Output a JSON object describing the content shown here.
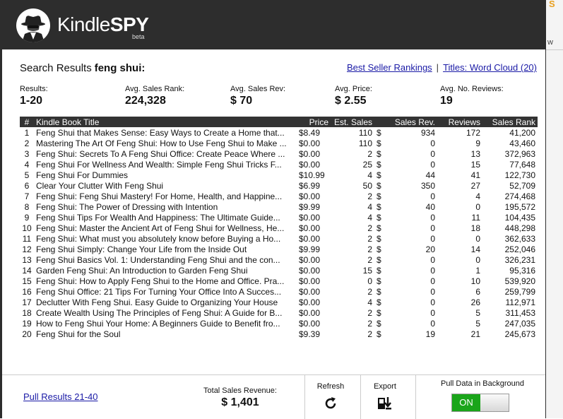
{
  "background": {
    "corner_text": "S",
    "side_text": "w"
  },
  "header": {
    "brand_normal": "Kindle",
    "brand_bold": "SPY",
    "beta": "beta"
  },
  "search": {
    "label": "Search Results",
    "term": "feng shui:"
  },
  "links": {
    "best_seller": "Best Seller Rankings",
    "pipe": "|",
    "word_cloud": "Titles: Word Cloud (20)"
  },
  "stats": [
    {
      "label": "Results:",
      "value": "1-20"
    },
    {
      "label": "Avg. Sales Rank:",
      "value": "224,328"
    },
    {
      "label": "Avg. Sales Rev:",
      "value": "$ 70"
    },
    {
      "label": "Avg. Price:",
      "value": "$ 2.55"
    },
    {
      "label": "Avg. No. Reviews:",
      "value": "19"
    }
  ],
  "table": {
    "headers": [
      "#",
      "Kindle Book Title",
      "Price",
      "Est. Sales",
      "Sales Rev.",
      "Reviews",
      "Sales Rank"
    ],
    "rows": [
      [
        "1",
        "Feng Shui that Makes Sense: Easy Ways to Create a Home that...",
        "$8.49",
        "110",
        "$",
        "934",
        "172",
        "41,200"
      ],
      [
        "2",
        "Mastering The Art Of Feng Shui: How to Use Feng Shui to Make ...",
        "$0.00",
        "110",
        "$",
        "0",
        "9",
        "43,460"
      ],
      [
        "3",
        "Feng Shui: Secrets To A Feng Shui Office: Create Peace Where ...",
        "$0.00",
        "2",
        "$",
        "0",
        "13",
        "372,963"
      ],
      [
        "4",
        "Feng Shui For Wellness And Wealth: Simple Feng Shui Tricks F...",
        "$0.00",
        "25",
        "$",
        "0",
        "15",
        "77,648"
      ],
      [
        "5",
        "Feng Shui For Dummies",
        "$10.99",
        "4",
        "$",
        "44",
        "41",
        "122,730"
      ],
      [
        "6",
        "Clear Your Clutter With Feng Shui",
        "$6.99",
        "50",
        "$",
        "350",
        "27",
        "52,709"
      ],
      [
        "7",
        "Feng Shui: Feng Shui Mastery! For Home, Health, and Happine...",
        "$0.00",
        "2",
        "$",
        "0",
        "4",
        "274,468"
      ],
      [
        "8",
        "Feng Shui: The Power of Dressing with Intention",
        "$9.99",
        "4",
        "$",
        "40",
        "0",
        "195,572"
      ],
      [
        "9",
        "Feng Shui Tips For Wealth And Happiness: The Ultimate Guide...",
        "$0.00",
        "4",
        "$",
        "0",
        "11",
        "104,435"
      ],
      [
        "10",
        "Feng Shui: Master the Ancient Art of Feng Shui for Wellness, He...",
        "$0.00",
        "2",
        "$",
        "0",
        "18",
        "448,298"
      ],
      [
        "11",
        "Feng Shui: What must you absolutely know before Buying a Ho...",
        "$0.00",
        "2",
        "$",
        "0",
        "0",
        "362,633"
      ],
      [
        "12",
        "Feng Shui Simply: Change Your Life from the Inside Out",
        "$9.99",
        "2",
        "$",
        "20",
        "14",
        "252,046"
      ],
      [
        "13",
        "Feng Shui Basics Vol. 1: Understanding Feng Shui and the con...",
        "$0.00",
        "2",
        "$",
        "0",
        "0",
        "326,231"
      ],
      [
        "14",
        "Garden Feng Shui: An Introduction to Garden Feng Shui",
        "$0.00",
        "15",
        "$",
        "0",
        "1",
        "95,316"
      ],
      [
        "15",
        "Feng Shui: How to Apply Feng Shui to the Home and Office. Pra...",
        "$0.00",
        "0",
        "$",
        "0",
        "10",
        "539,920"
      ],
      [
        "16",
        "Feng Shui Office: 21 Tips For Turning Your Office Into A Succes...",
        "$0.00",
        "2",
        "$",
        "0",
        "6",
        "259,799"
      ],
      [
        "17",
        "Declutter With Feng Shui. Easy Guide to Organizing Your House",
        "$0.00",
        "4",
        "$",
        "0",
        "26",
        "112,971"
      ],
      [
        "18",
        "Create Wealth Using The Principles of Feng Shui: A Guide for B...",
        "$0.00",
        "2",
        "$",
        "0",
        "5",
        "311,453"
      ],
      [
        "19",
        "How to Feng Shui Your Home: A Beginners Guide to Benefit fro...",
        "$0.00",
        "2",
        "$",
        "0",
        "5",
        "247,035"
      ],
      [
        "20",
        "Feng Shui for the Soul",
        "$9.39",
        "2",
        "$",
        "19",
        "21",
        "245,673"
      ]
    ]
  },
  "footer": {
    "pull_more": "Pull Results 21-40",
    "total_label": "Total Sales Revenue:",
    "total_value": "$ 1,401",
    "refresh": "Refresh",
    "export": "Export",
    "bg_label": "Pull Data in Background",
    "toggle": "ON"
  },
  "colors": {
    "header_bg": "#2d2d2d",
    "toggle_on": "#1aa51a",
    "link": "#1a1aa6"
  },
  "icons": {
    "logo": "spy-logo-icon",
    "refresh": "refresh-icon",
    "export": "export-icon"
  }
}
